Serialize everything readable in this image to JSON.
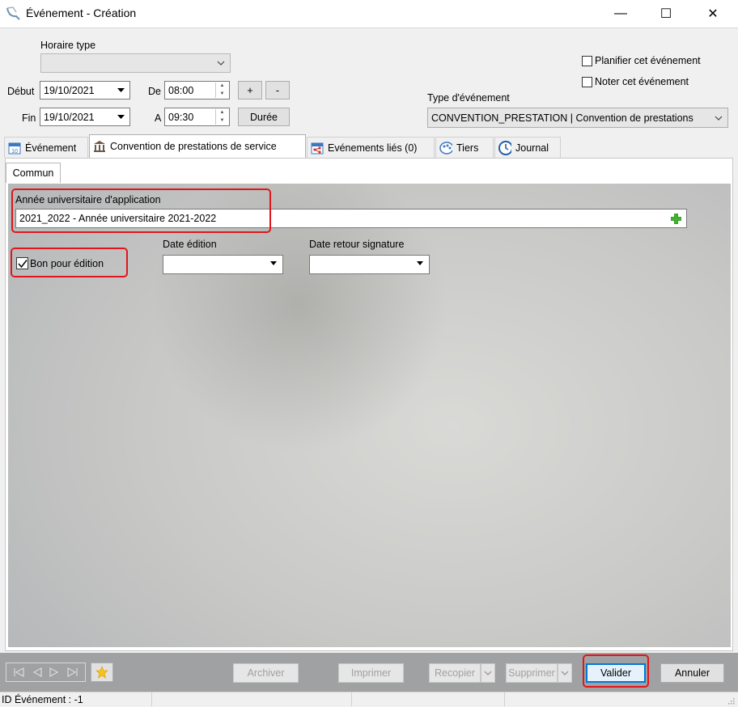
{
  "window": {
    "title": "Événement  - Création",
    "controls": {
      "minimize": "—",
      "maximize": "☐",
      "close": "✕"
    }
  },
  "header": {
    "horaire_type": {
      "label": "Horaire type",
      "value": ""
    },
    "debut": {
      "label": "Début",
      "date": "19/10/2021",
      "time_label": "De",
      "time": "08:00"
    },
    "fin": {
      "label": "Fin",
      "date": "19/10/2021",
      "time_label": "A",
      "time": "09:30"
    },
    "plus_label": "+",
    "minus_label": "-",
    "duree_label": "Durée",
    "planifier_label": "Planifier cet événement",
    "noter_label": "Noter cet événement",
    "type_label": "Type d'événement",
    "type_value": "CONVENTION_PRESTATION | Convention de prestations"
  },
  "tabs": [
    {
      "label": "Événement",
      "icon": "calendar-icon"
    },
    {
      "label": "Convention de prestations de service",
      "icon": "building-icon",
      "active": true
    },
    {
      "label": "Evénements liés (0)",
      "icon": "share-icon"
    },
    {
      "label": "Tiers",
      "icon": "palette-icon"
    },
    {
      "label": "Journal",
      "icon": "clock-icon"
    }
  ],
  "subtab": {
    "label": "Commun"
  },
  "form": {
    "annee_label": "Année universitaire d'application",
    "annee_value": "2021_2022 - Année universitaire 2021-2022",
    "bon_label": "Bon pour édition",
    "bon_checked": true,
    "date_edition_label": "Date édition",
    "date_edition_value": "",
    "date_retour_label": "Date retour signature",
    "date_retour_value": ""
  },
  "footer": {
    "archiver": "Archiver",
    "imprimer": "Imprimer",
    "recopier": "Recopier",
    "supprimer": "Supprimer",
    "valider": "Valider",
    "annuler": "Annuler"
  },
  "status": {
    "id_text": "ID Événement : -1"
  },
  "colors": {
    "highlight": "#e0161c",
    "accent": "#0078d7"
  }
}
